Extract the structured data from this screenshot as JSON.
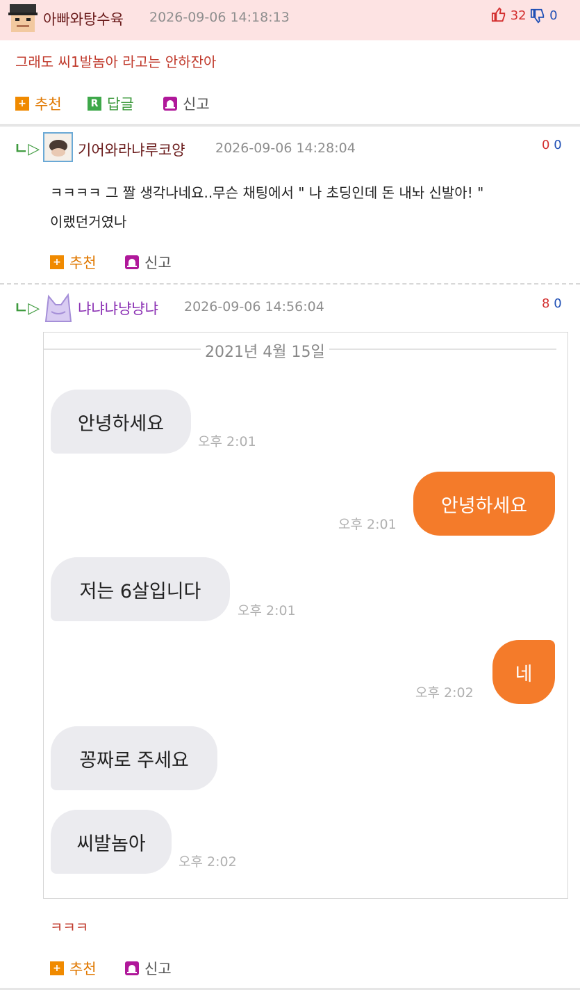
{
  "comments": [
    {
      "username": "아빠와탕수육",
      "timestamp": "2026-09-06 14:18:13",
      "upvotes": "32",
      "downvotes": "0",
      "text": "그래도 씨1발놈아 라고는 안하잔아",
      "actions": {
        "recommend": "추천",
        "reply": "답글",
        "report": "신고"
      }
    },
    {
      "username": "기어와라냐루코양",
      "timestamp": "2026-09-06 14:28:04",
      "upvotes": "0",
      "downvotes": "0",
      "text_line1": "ㅋㅋㅋㅋ 그 짤 생각나네요..무슨 채팅에서 \" 나 초딩인데 돈 내놔 신발아! \"",
      "text_line2": "이랬던거였나",
      "actions": {
        "recommend": "추천",
        "report": "신고"
      }
    },
    {
      "username": "냐냐냐냥냥냐",
      "timestamp": "2026-09-06 14:56:04",
      "upvotes": "8",
      "downvotes": "0",
      "text": "ㅋㅋㅋ",
      "actions": {
        "recommend": "추천",
        "report": "신고"
      }
    }
  ],
  "chat_image": {
    "date": "2021년 4월 15일",
    "messages": [
      {
        "side": "left",
        "text": "안녕하세요",
        "time": "오후 2:01"
      },
      {
        "side": "right",
        "text": "안녕하세요",
        "time": "오후 2:01"
      },
      {
        "side": "left",
        "text": "저는 6살입니다",
        "time": "오후 2:01"
      },
      {
        "side": "right",
        "text": "네",
        "time": "오후 2:02"
      },
      {
        "side": "left",
        "text": "꽁짜로 주세요",
        "time": ""
      },
      {
        "side": "left",
        "text": "씨발놈아",
        "time": "오후 2:02"
      }
    ]
  },
  "icons": {
    "reply_arrow": "ㄴ▷",
    "recommend": "+",
    "reply": "R",
    "thumb_up": "👍",
    "thumb_down": "👎"
  },
  "colors": {
    "header_bg": "#fde3e3",
    "upvote": "#d32f2f",
    "downvote": "#1f4fb5",
    "my_bubble": "#f47b2a",
    "their_bubble": "#ebebef"
  }
}
